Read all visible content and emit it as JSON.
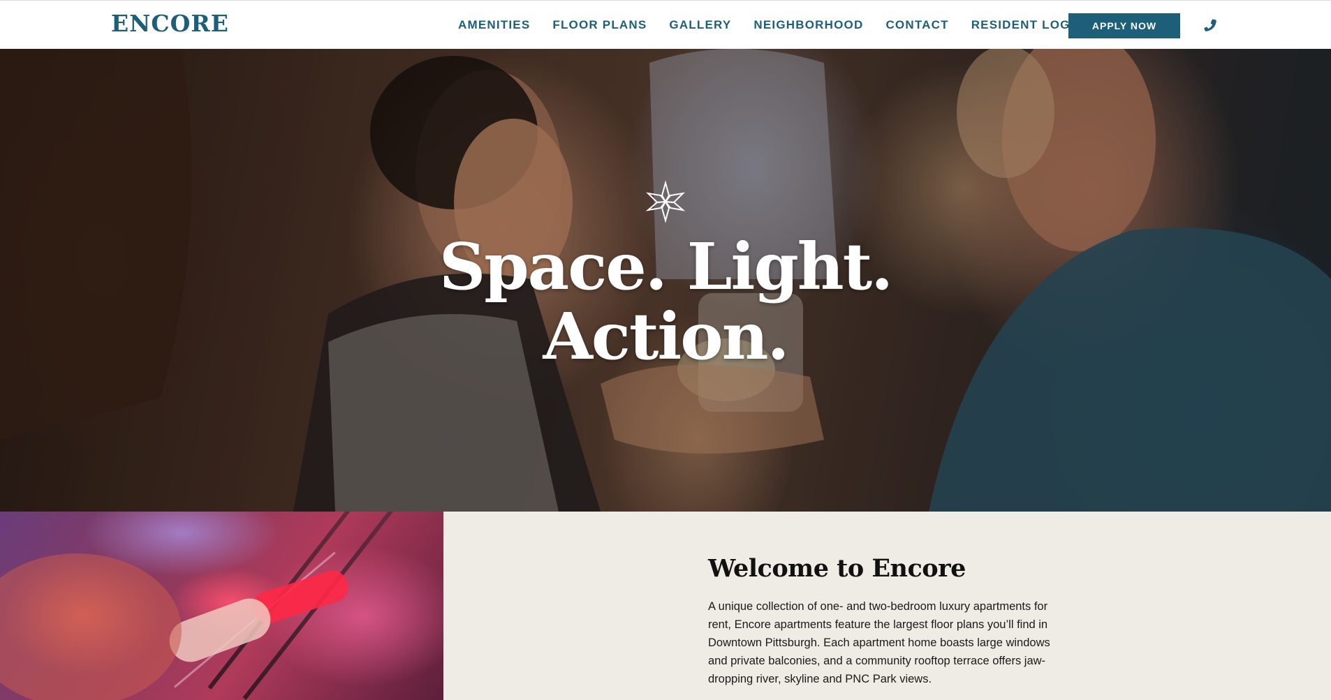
{
  "header": {
    "logo": "ENCORE",
    "nav": [
      {
        "label": "AMENITIES"
      },
      {
        "label": "FLOOR PLANS"
      },
      {
        "label": "GALLERY"
      },
      {
        "label": "NEIGHBORHOOD"
      },
      {
        "label": "CONTACT"
      },
      {
        "label": "RESIDENT LOGIN"
      }
    ],
    "apply_button": "APPLY NOW",
    "phone_icon": "phone-icon"
  },
  "hero": {
    "emblem_icon": "star-emblem-icon",
    "heading_line1": "Space. Light.",
    "heading_line2": "Action."
  },
  "welcome": {
    "title": "Welcome to Encore",
    "body": "A unique collection of one- and two-bedroom luxury apartments for rent, Encore apartments feature the largest floor plans you’ll find in Downtown Pittsburgh. Each apartment home boasts large windows and private balconies, and a community rooftop terrace offers jaw-dropping river, skyline and PNC Park views."
  },
  "colors": {
    "brand": "#1d5f79",
    "panel_background": "#efece6",
    "hero_text": "#ffffff"
  }
}
